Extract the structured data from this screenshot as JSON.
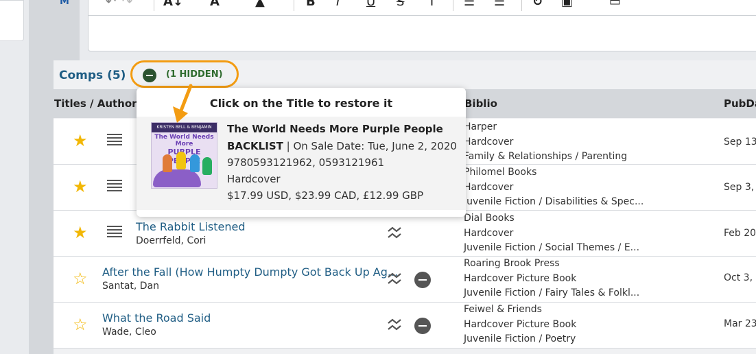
{
  "sidebar_label": "M",
  "comps": {
    "title": "Comps (5)",
    "hidden_label": "(1 HIDDEN)"
  },
  "table": {
    "headers": {
      "titles": "Titles / Author",
      "biblio": "Biblio",
      "pubdate": "PubDa"
    },
    "rows": [
      {
        "starred": true,
        "title": "",
        "author": "",
        "biblio": [
          "Harper",
          "Hardcover",
          "Family & Relationships / Parenting"
        ],
        "pubdate": "Sep 13"
      },
      {
        "starred": true,
        "title": "",
        "author": "",
        "biblio": [
          "Philomel Books",
          "Hardcover",
          "Juvenile Fiction / Disabilities & Spec..."
        ],
        "pubdate": "Sep 3,"
      },
      {
        "starred": true,
        "title": "The Rabbit Listened",
        "author": "Doerrfeld, Cori",
        "biblio": [
          "Dial Books",
          "Hardcover",
          "Juvenile Fiction / Social Themes / E..."
        ],
        "pubdate": "Feb 20"
      },
      {
        "starred": false,
        "title": "After the Fall (How Humpty Dumpty Got Back Up Ag...",
        "author": "Santat, Dan",
        "biblio": [
          "Roaring Brook Press",
          "Hardcover Picture Book",
          "Juvenile Fiction / Fairy Tales & Folkl..."
        ],
        "pubdate": "Oct 3,"
      },
      {
        "starred": false,
        "title": "What the Road Said",
        "author": "Wade, Cleo",
        "biblio": [
          "Feiwel & Friends",
          "Hardcover Picture Book",
          "Juvenile Fiction / Poetry"
        ],
        "pubdate": "Mar 23"
      }
    ]
  },
  "popup": {
    "header": "Click on the Title to restore it",
    "book_title": "The World Needs More Purple People",
    "status": "BACKLIST",
    "on_sale": "| On Sale Date: Tue, June 2, 2020",
    "isbns": "9780593121962, 0593121961",
    "format": "Hardcover",
    "price": "$17.99 USD, $23.99 CAD, £12.99 GBP",
    "cover": {
      "authors": "KRISTEN BELL & BENJAMIN HART",
      "title_line1": "The World Needs More",
      "title_line2": "PURPLE PEOPLE"
    }
  },
  "colors": {
    "accent_orange": "#f39c12",
    "link_blue": "#1f5d84",
    "star_yellow": "#f2b705",
    "hidden_green": "#2e6b2e"
  }
}
